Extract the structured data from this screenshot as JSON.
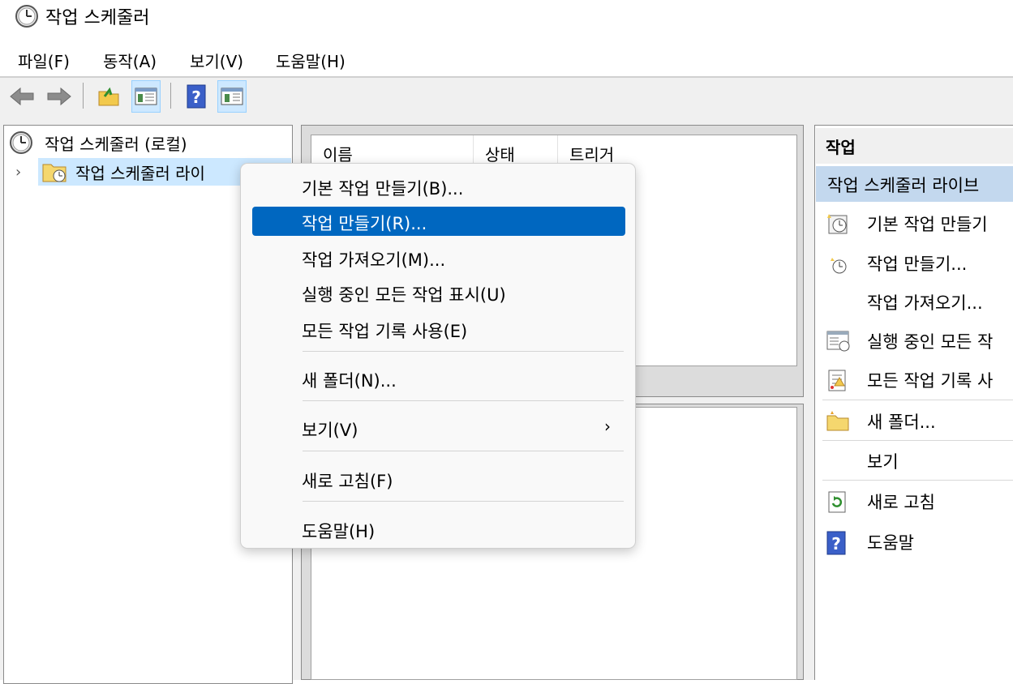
{
  "window": {
    "title": "작업 스케줄러"
  },
  "menubar": {
    "items": [
      "파일(F)",
      "동작(A)",
      "보기(V)",
      "도움말(H)"
    ]
  },
  "toolbar": {
    "buttons": [
      "back-icon",
      "forward-icon",
      "up-folder-icon",
      "show-hide-console-tree-icon",
      "help-icon",
      "show-hide-action-pane-icon"
    ]
  },
  "tree": {
    "root_label": "작업 스케줄러 (로컬)",
    "child_label": "작업 스케줄러 라이"
  },
  "list": {
    "columns": [
      "이름",
      "상태",
      "트리거"
    ]
  },
  "actions": {
    "header": "작업",
    "section_title": "작업 스케줄러 라이브",
    "items": [
      {
        "label": "기본 작업 만들기",
        "icon": "create-basic-task-icon"
      },
      {
        "label": "작업 만들기...",
        "icon": "create-task-icon"
      },
      {
        "label": "작업 가져오기...",
        "icon": ""
      },
      {
        "label": "실행 중인 모든 작",
        "icon": "running-tasks-icon"
      },
      {
        "label": "모든 작업 기록 사",
        "icon": "task-history-icon"
      },
      {
        "label": "새 폴더...",
        "icon": "new-folder-icon"
      },
      {
        "label": "보기",
        "icon": ""
      },
      {
        "label": "새로 고침",
        "icon": "refresh-icon"
      },
      {
        "label": "도움말",
        "icon": "help-icon"
      }
    ]
  },
  "context_menu": {
    "items": [
      "기본 작업 만들기(B)...",
      "작업 만들기(R)...",
      "작업 가져오기(M)...",
      "실행 중인 모든 작업 표시(U)",
      "모든 작업 기록 사용(E)",
      "새 폴더(N)...",
      "보기(V)",
      "새로 고침(F)",
      "도움말(H)"
    ],
    "highlighted_index": 1,
    "submenu_arrow": "›"
  },
  "colors": {
    "highlight": "#0067c0",
    "selection": "#cce8ff",
    "action_section": "#c3d8ee"
  }
}
